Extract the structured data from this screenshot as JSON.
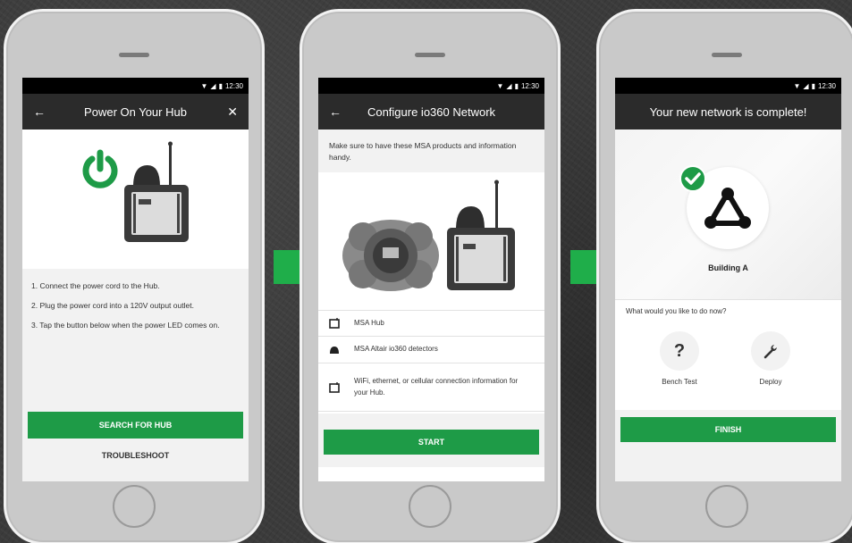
{
  "statusbar": {
    "time": "12:30"
  },
  "screen1": {
    "title": "Power On Your Hub",
    "steps": [
      "1. Connect the power cord to the Hub.",
      "2. Plug the power cord into a 120V output outlet.",
      "3. Tap the button below when the power LED comes on."
    ],
    "primary_button": "SEARCH FOR HUB",
    "secondary_button": "TROUBLESHOOT"
  },
  "screen2": {
    "title": "Configure io360 Network",
    "intro": "Make sure to have these MSA products and information handy.",
    "items": [
      "MSA Hub",
      "MSA Altair io360 detectors",
      "WiFi, ethernet, or cellular connection information for your Hub."
    ],
    "primary_button": "START"
  },
  "screen3": {
    "title": "Your new network is complete!",
    "network_name": "Building A",
    "question": "What would you like to do now?",
    "actions": [
      "Bench Test",
      "Deploy"
    ],
    "primary_button": "FINISH"
  },
  "colors": {
    "accent": "#1e9b47",
    "appbar": "#2b2b2b"
  },
  "icons": [
    "back-arrow-icon",
    "close-icon",
    "power-icon",
    "hub-device-icon",
    "detector-icon",
    "check-icon",
    "network-icon",
    "question-icon",
    "wrench-icon",
    "next-arrow-icon"
  ]
}
